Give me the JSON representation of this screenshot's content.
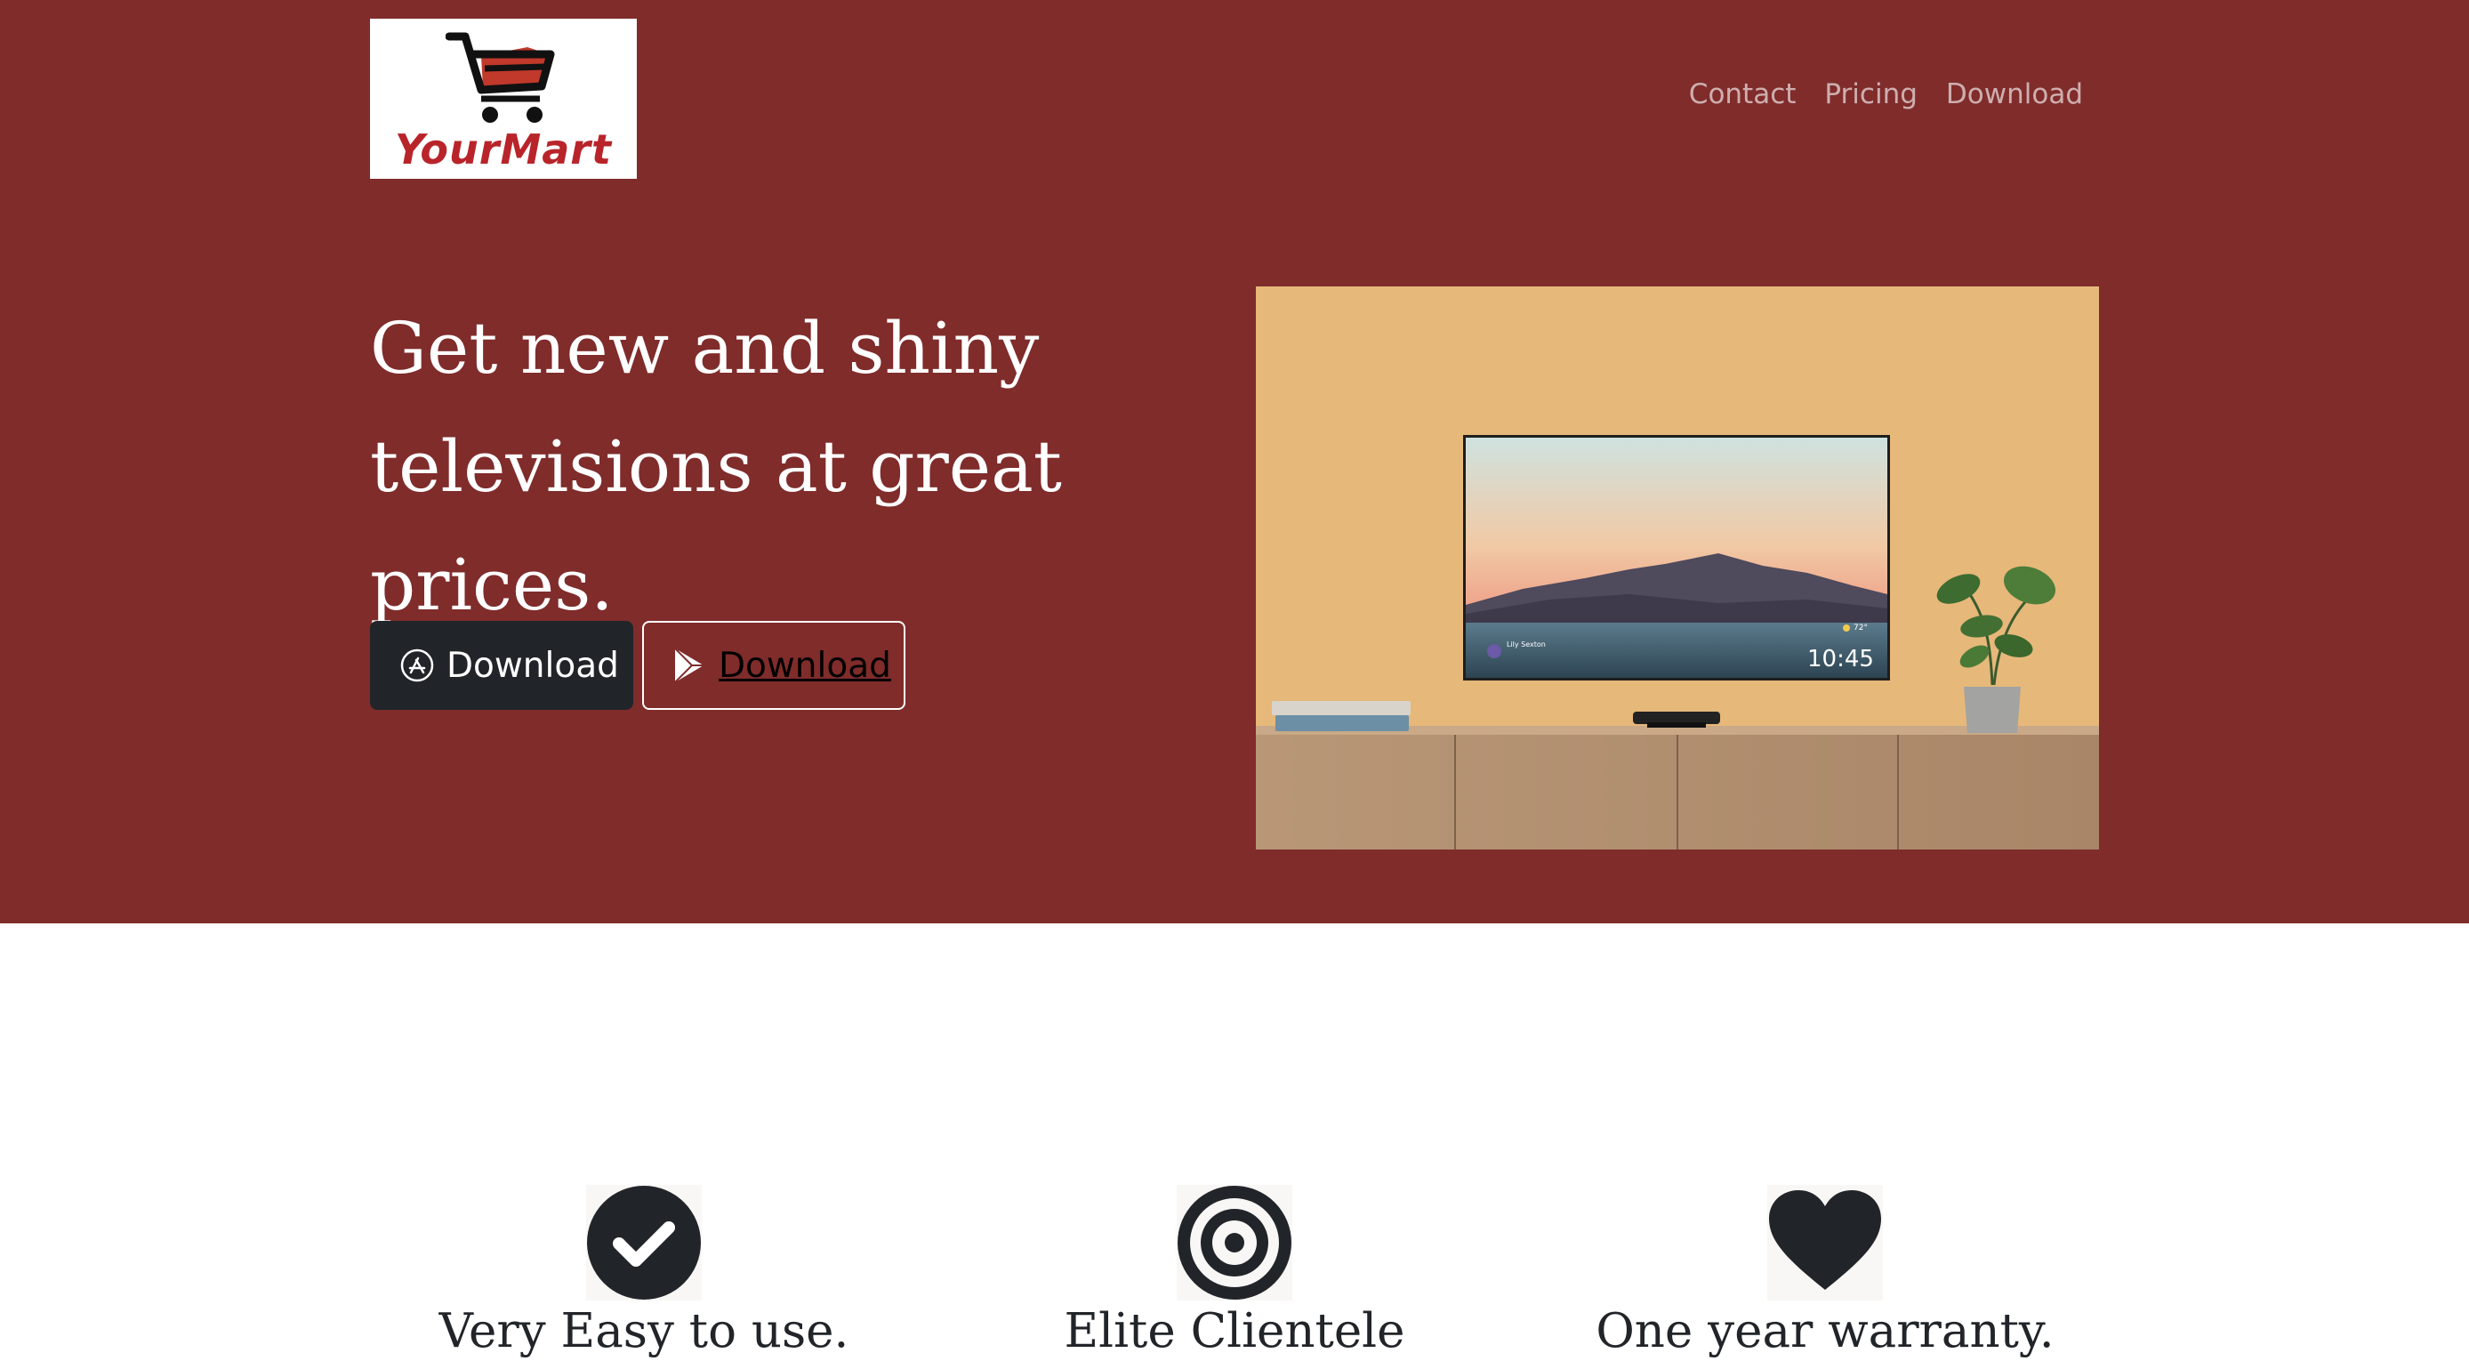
{
  "brand": {
    "logo_text": "YourMart",
    "accent": "#b8242a",
    "hero_bg": "#7f2c2b"
  },
  "nav": {
    "items": [
      "Contact",
      "Pricing",
      "Download"
    ]
  },
  "hero": {
    "headline_line1": "Get new and shiny",
    "headline_line2": "televisions at great prices.",
    "btn_appstore": "Download",
    "btn_playstore": "Download",
    "appstore_icon": "app-store-icon",
    "playstore_icon": "google-play-icon"
  },
  "tv_screen": {
    "clock": "10:45",
    "user": "Lily Sexton",
    "temperature": "72°"
  },
  "features": [
    {
      "title": "Very Easy to use.",
      "icon": "check-circle-icon"
    },
    {
      "title": "Elite Clientele",
      "icon": "bullseye-icon"
    },
    {
      "title": "One year warranty.",
      "icon": "heart-icon"
    }
  ]
}
